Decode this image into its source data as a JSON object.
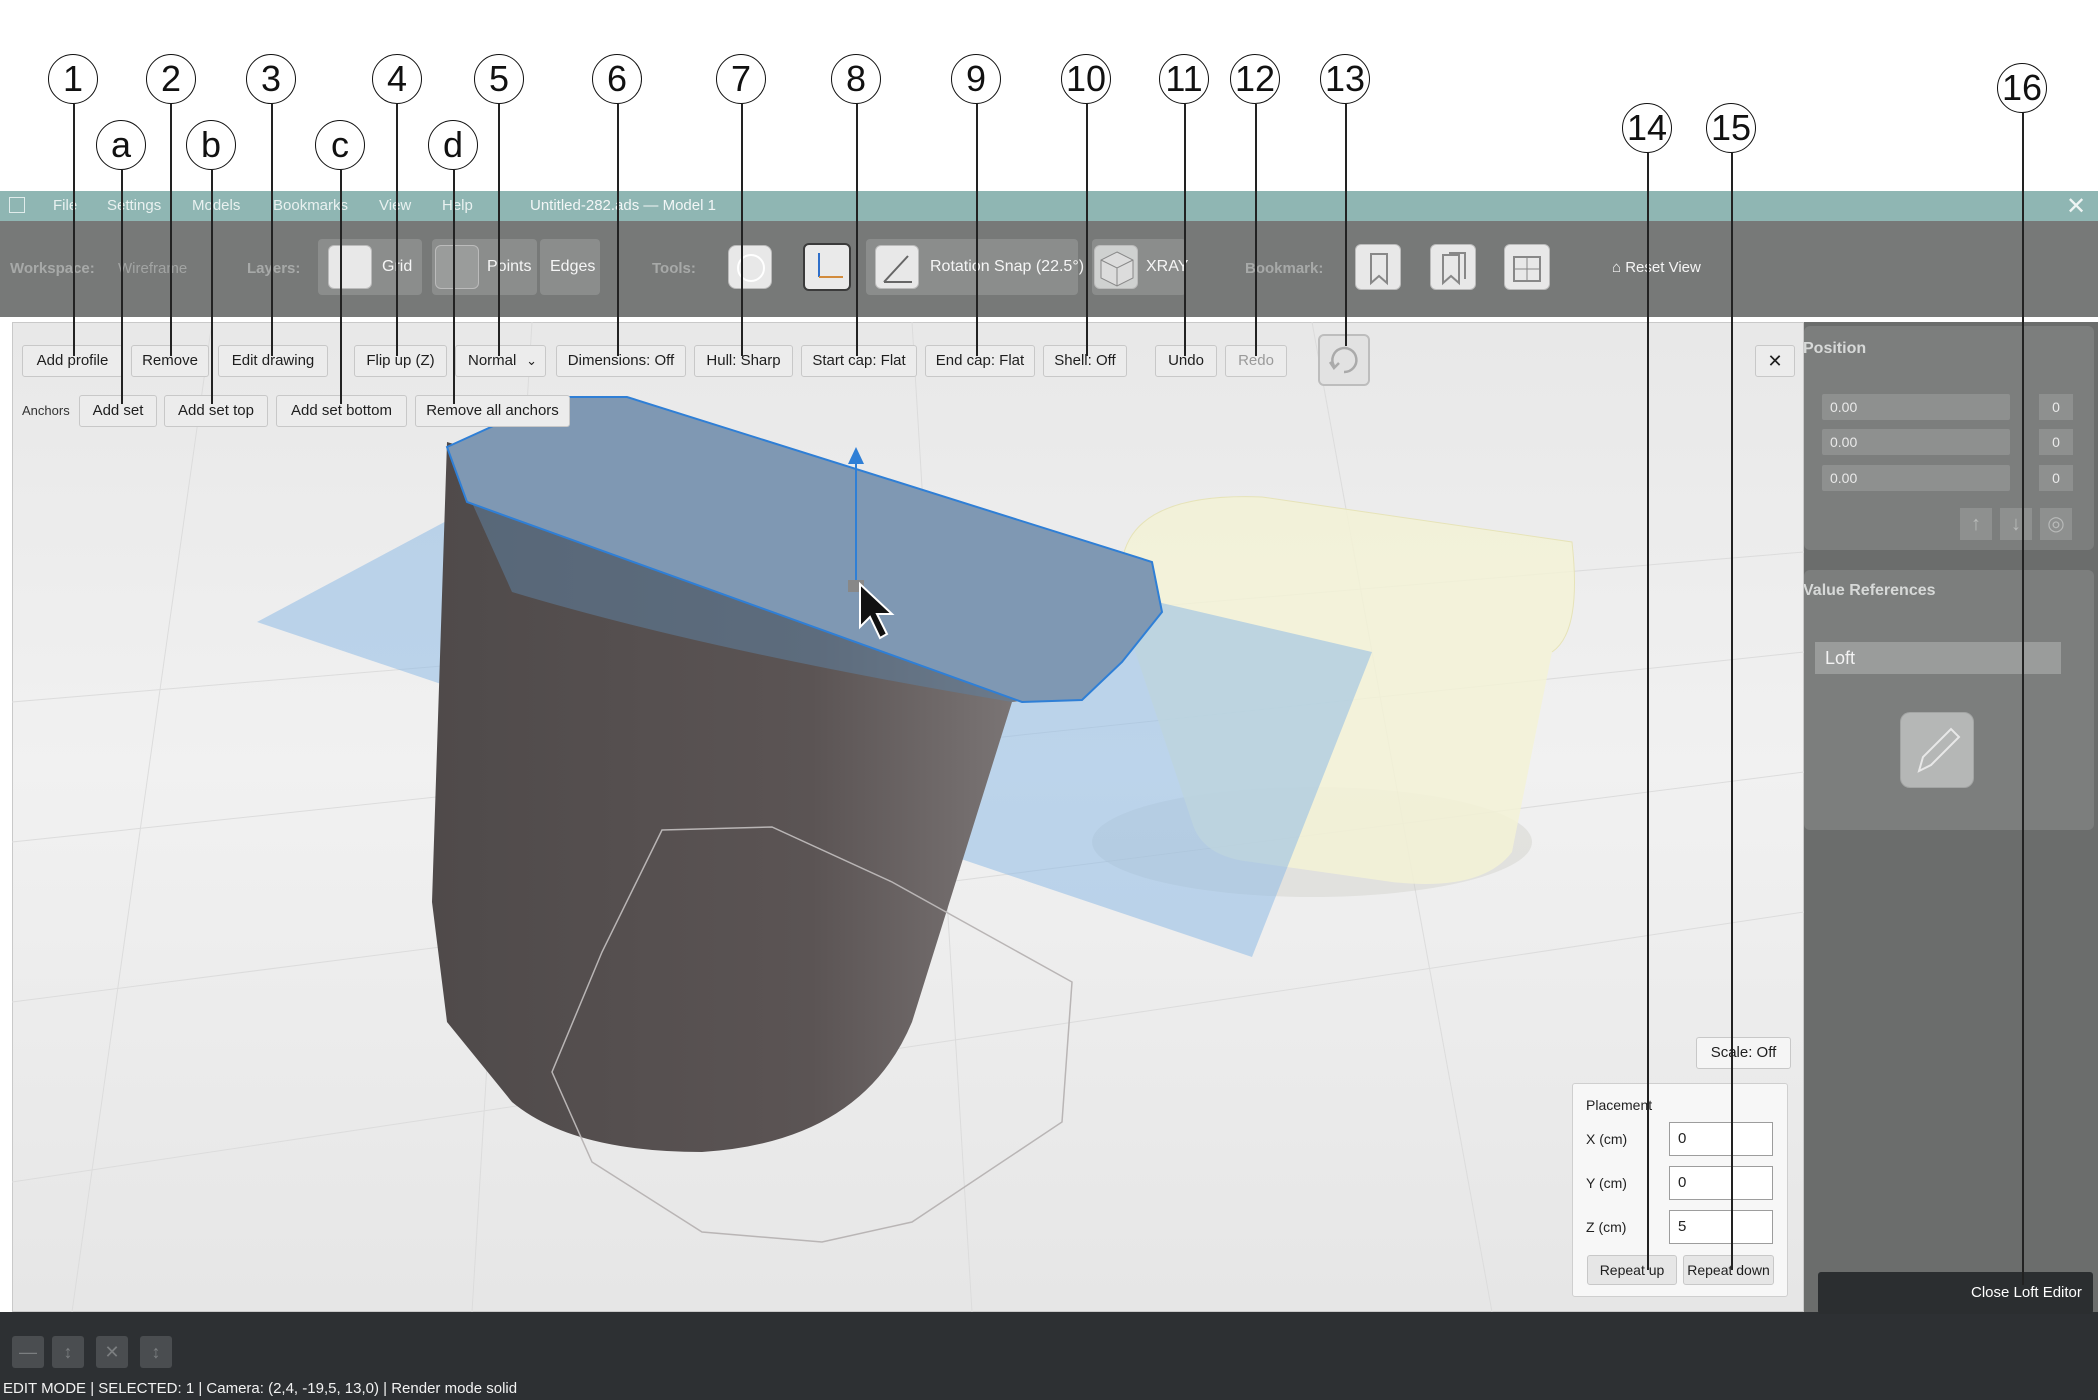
{
  "callouts": {
    "numbers": [
      "1",
      "2",
      "3",
      "4",
      "5",
      "6",
      "7",
      "8",
      "9",
      "10",
      "11",
      "12",
      "13",
      "14",
      "15",
      "16"
    ],
    "letters": [
      "a",
      "b",
      "c",
      "d"
    ]
  },
  "menubar": {
    "items": [
      "File",
      "Settings",
      "Models",
      "Bookmarks",
      "View",
      "Help"
    ],
    "title": "Untitled-282.ads — Model 1"
  },
  "toolbar": {
    "workspace_label": "Workspace:",
    "workspace_value": "Wireframe",
    "layers_label": "Layers:",
    "grid": "Grid",
    "points": "Points",
    "edges": "Edges",
    "tools_label": "Tools:",
    "rotation_snap": "Rotation Snap (22.5°)",
    "xray": "XRAY",
    "bookmark_label": "Bookmark:",
    "reset_view": "⌂ Reset View"
  },
  "loft": {
    "buttons": {
      "add_profile": "Add profile",
      "remove": "Remove",
      "edit_drawing": "Edit drawing",
      "flip_up": "Flip up (Z)",
      "normal": "Normal",
      "dimensions": "Dimensions: Off",
      "hull": "Hull: Sharp",
      "start_cap": "Start cap: Flat",
      "end_cap": "End cap: Flat",
      "shell": "Shell: Off",
      "undo": "Undo",
      "redo": "Redo"
    },
    "anchors_label": "Anchors",
    "anchors": {
      "add_set": "Add set",
      "add_set_top": "Add set top",
      "add_set_bottom": "Add set bottom",
      "remove_all": "Remove all anchors"
    },
    "scale": "Scale: Off",
    "placement": {
      "title": "Placement",
      "x_label": "X (cm)",
      "x_value": "0",
      "y_label": "Y (cm)",
      "y_value": "0",
      "z_label": "Z (cm)",
      "z_value": "5",
      "repeat_up": "Repeat up",
      "repeat_down": "Repeat down"
    },
    "close_editor": "Close Loft Editor"
  },
  "right_panel": {
    "position_title": "Position",
    "rows": [
      {
        "value": "0.00",
        "small": "0"
      },
      {
        "value": "0.00",
        "small": "0"
      },
      {
        "value": "0.00",
        "small": "0"
      }
    ],
    "value_refs_title": "Value References",
    "loft_label": "Loft"
  },
  "status": "EDIT MODE | SELECTED: 1 | Camera: (2,4, -19,5, 13,0) | Render mode solid",
  "colors": {
    "menubar": "#8fb6b3",
    "toolbar": "#777978",
    "selection_blue": "#2f7fd6",
    "bottom_bar": "#2d3033"
  }
}
